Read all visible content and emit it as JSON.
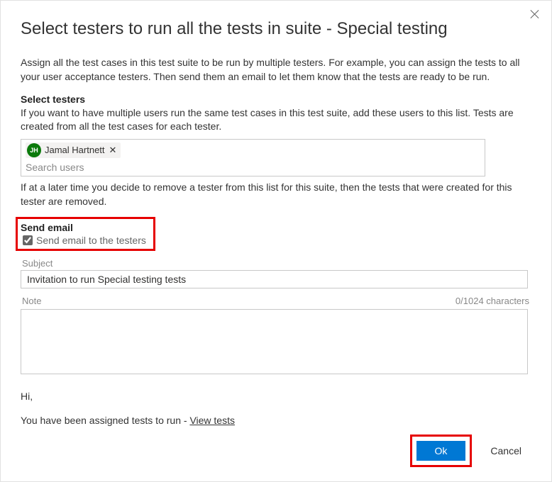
{
  "dialog": {
    "title": "Select testers to run all the tests in suite - Special testing",
    "intro": "Assign all the test cases in this test suite to be run by multiple testers. For example, you can assign the tests to all your user acceptance testers. Then send them an email to let them know that the tests are ready to be run."
  },
  "selectTesters": {
    "header": "Select testers",
    "description": "If you want to have multiple users run the same test cases in this test suite, add these users to this list. Tests are created from all the test cases for each tester.",
    "chips": [
      {
        "initials": "JH",
        "name": "Jamal Hartnett"
      }
    ],
    "searchPlaceholder": "Search users",
    "removeNote": "If at a later time you decide to remove a tester from this list for this suite, then the tests that were created for this tester are removed."
  },
  "sendEmail": {
    "header": "Send email",
    "checkboxLabel": "Send email to the testers",
    "checked": true,
    "subjectLabel": "Subject",
    "subjectValue": "Invitation to run Special testing tests",
    "noteLabel": "Note",
    "noteCounter": "0/1024 characters"
  },
  "preview": {
    "greeting": "Hi,",
    "line": "You have been assigned tests to run - ",
    "linkText": "View tests"
  },
  "buttons": {
    "ok": "Ok",
    "cancel": "Cancel"
  }
}
